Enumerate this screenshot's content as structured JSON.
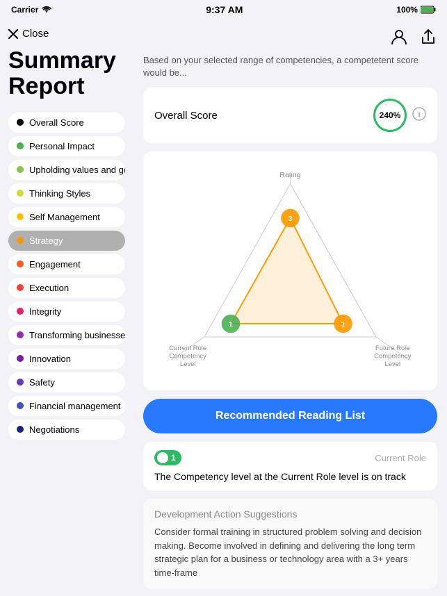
{
  "statusBar": {
    "carrier": "Carrier",
    "time": "9:37 AM",
    "battery": "100%"
  },
  "header": {
    "close_label": "Close",
    "title_line1": "Summary",
    "title_line2": "Report",
    "user_icon": "👤",
    "share_icon": "⬆"
  },
  "summary": {
    "description": "Based on your selected range of competencies, a competetent score would be..."
  },
  "overallScore": {
    "label": "Overall Score",
    "value": "240%",
    "info": "ⓘ"
  },
  "chart": {
    "rating_label": "Rating",
    "axis1": "Current Role\nCompetency\nLevel",
    "axis2": "Future Role\nCompetency\nLevel",
    "node_top": "3",
    "node_left": "1",
    "node_right": "1"
  },
  "readingBtn": {
    "label": "Recommended Reading List"
  },
  "statusBadge": {
    "value": "1",
    "role": "Current Role",
    "message": "The Competency level at the Current Role level is on track"
  },
  "development": {
    "title": "Development Action Suggestions",
    "text": "Consider formal training in structured problem solving and decision making. Become involved in defining and delivering the long term strategic plan for a business or technology area with a 3+ years time-frame"
  },
  "nav": {
    "items": [
      {
        "label": "Overall Score",
        "color": "#000000",
        "active": false
      },
      {
        "label": "Personal Impact",
        "color": "#4caf50",
        "active": false
      },
      {
        "label": "Upholding values and goals",
        "color": "#8bc34a",
        "active": false
      },
      {
        "label": "Thinking Styles",
        "color": "#cddc39",
        "active": false
      },
      {
        "label": "Self Management",
        "color": "#ffc107",
        "active": false
      },
      {
        "label": "Strategy",
        "color": "#ff9800",
        "active": true
      },
      {
        "label": "Engagement",
        "color": "#ff5722",
        "active": false
      },
      {
        "label": "Execution",
        "color": "#f44336",
        "active": false
      },
      {
        "label": "Integrity",
        "color": "#e91e63",
        "active": false
      },
      {
        "label": "Transforming businesses",
        "color": "#9c27b0",
        "active": false
      },
      {
        "label": "Innovation",
        "color": "#7b1fa2",
        "active": false
      },
      {
        "label": "Safety",
        "color": "#673ab7",
        "active": false
      },
      {
        "label": "Financial management",
        "color": "#3f51b5",
        "active": false
      },
      {
        "label": "Negotiations",
        "color": "#1a237e",
        "active": false
      }
    ]
  }
}
